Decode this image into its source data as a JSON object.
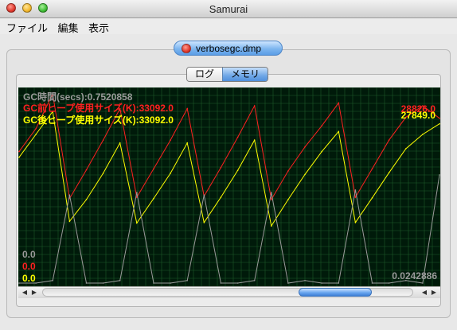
{
  "window": {
    "title": "Samurai"
  },
  "menu": [
    "ファイル",
    "編集",
    "表示"
  ],
  "document_tab": {
    "label": "verbosegc.dmp"
  },
  "view_tabs": [
    {
      "label": "ログ",
      "selected": false
    },
    {
      "label": "メモリ",
      "selected": true
    }
  ],
  "overlay": {
    "gc_time": "GC時間(secs):0.7520858",
    "heap_before": "GC前ヒープ使用サイズ(K):33092.0",
    "heap_after": "GC後ヒープ使用サイズ(K):33092.0",
    "right_red": "28826.0",
    "right_yellow": "27849.0",
    "bottom_gray": "0.0",
    "bottom_red": "0.0",
    "bottom_yellow": "0.0",
    "bottom_right_gray": "0.0242886"
  },
  "colors": {
    "background": "#001a0a",
    "grid": "#1c5a28",
    "gc_time": "#9a9a9a",
    "heap_before": "#ff2020",
    "heap_after": "#ffff00"
  },
  "scrollbar": {
    "left_arrow": "◀",
    "right_arrow": "▶",
    "position": 0.86
  },
  "chart_data": {
    "type": "line",
    "x": [
      0,
      2,
      4,
      6,
      8,
      10,
      12,
      14,
      16,
      18,
      20,
      22,
      24,
      26,
      28,
      30,
      32,
      34,
      36,
      38,
      40,
      42,
      44,
      46,
      48,
      50
    ],
    "ylim": [
      0,
      33092
    ],
    "series": [
      {
        "name": "GC前ヒープ使用サイズ(K)",
        "values": [
          23000,
          27000,
          33092,
          14800,
          19800,
          25000,
          30500,
          15000,
          20000,
          25000,
          30500,
          15200,
          20200,
          25500,
          31000,
          14600,
          19600,
          23800,
          27500,
          31500,
          15000,
          20000,
          25000,
          29000,
          31000,
          28826
        ]
      },
      {
        "name": "GC後ヒープ使用サイズ(K)",
        "values": [
          22000,
          26000,
          30000,
          10800,
          14600,
          19200,
          24500,
          10500,
          14800,
          19200,
          24500,
          10600,
          15000,
          19700,
          25000,
          10000,
          14600,
          19000,
          23000,
          26500,
          10600,
          14900,
          19300,
          23500,
          26000,
          27849
        ]
      },
      {
        "name": "GC時間(secs)",
        "values": [
          0.0,
          0.0,
          0.01,
          0.35,
          0.0,
          0.0,
          0.01,
          0.36,
          0.0,
          0.0,
          0.01,
          0.35,
          0.0,
          0.0,
          0.01,
          0.36,
          0.0,
          0.01,
          0.0,
          0.0,
          0.37,
          0.0,
          0.0,
          0.01,
          0.0,
          0.43
        ]
      }
    ]
  }
}
